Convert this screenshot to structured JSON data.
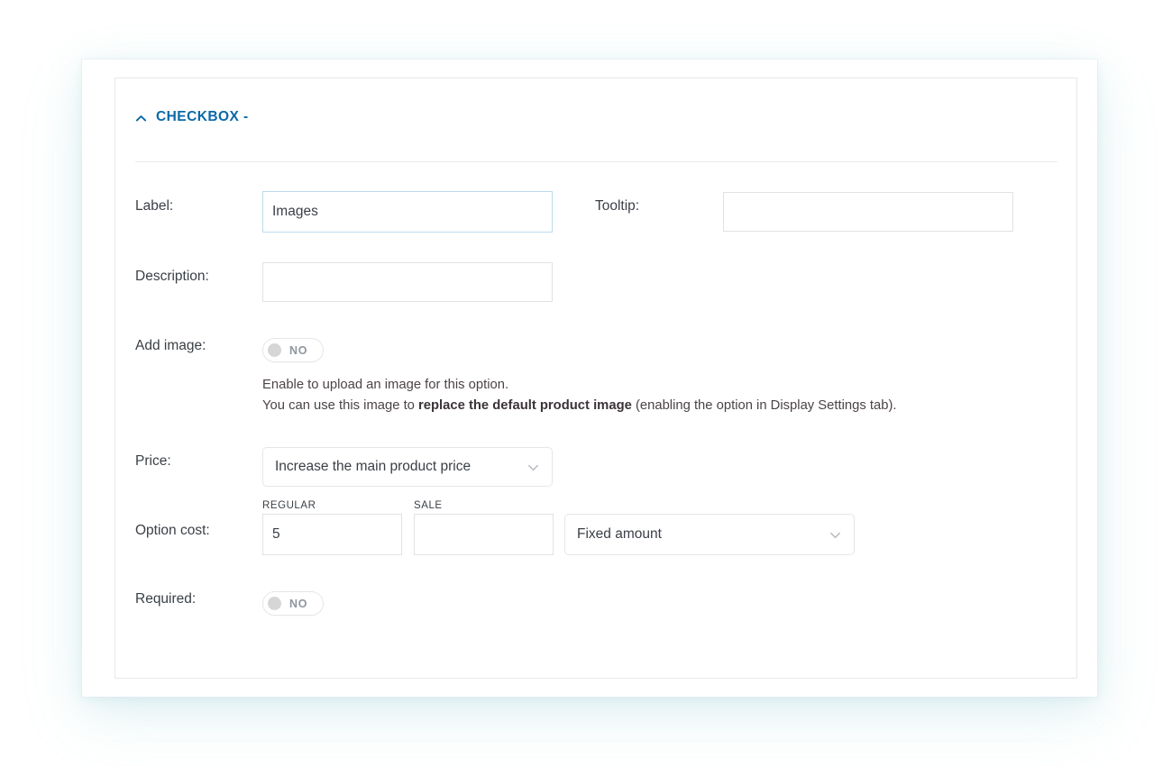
{
  "panel": {
    "section": {
      "title": "CHECKBOX -",
      "collapse_icon": "chevron-up-icon",
      "expanded": true
    },
    "fields": {
      "label": {
        "label": "Label:",
        "value": "Images",
        "placeholder": "",
        "focused": true
      },
      "tooltip": {
        "label": "Tooltip:",
        "value": "",
        "placeholder": ""
      },
      "description": {
        "label": "Description:",
        "value": "",
        "placeholder": ""
      },
      "add_image": {
        "label": "Add image:",
        "toggle_state": "NO",
        "helper_line_1": "Enable to upload an image for this option.",
        "helper_line_2_pre": "You can use this image to ",
        "helper_line_2_bold": "replace the default product image",
        "helper_line_2_post": " (enabling the option in Display Settings tab)."
      },
      "price": {
        "label": "Price:",
        "selected": "Increase the main product price",
        "chevron_icon": "chevron-down-icon"
      },
      "option_cost": {
        "label": "Option cost:",
        "regular_head": "REGULAR",
        "sale_head": "SALE",
        "regular_value": "5",
        "sale_value": "",
        "type_selected": "Fixed amount",
        "type_chevron_icon": "chevron-down-icon"
      },
      "required": {
        "label": "Required:",
        "toggle_state": "NO"
      }
    }
  },
  "colors": {
    "accent": "#0a69a8",
    "text": "#3a3f46",
    "border": "#e6e6e6",
    "focus_border": "#bcdcee",
    "toggle_knob": "#d6d6d6",
    "toggle_text": "#8f969e"
  }
}
